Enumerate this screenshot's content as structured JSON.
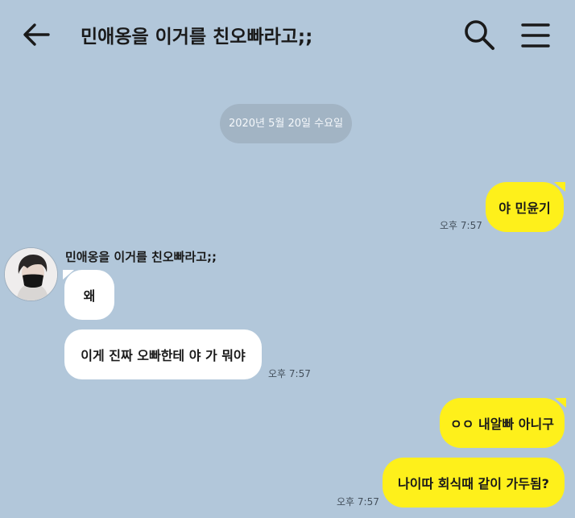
{
  "header": {
    "title": "민애옹을 이거를 친오빠라고;;",
    "back_icon": "arrow-left-icon",
    "search_icon": "search-icon",
    "menu_icon": "hamburger-menu-icon"
  },
  "date_divider": "2020년 5월 20일 수요일",
  "sender": {
    "name": "민애옹을 이거를 친오빠라고;;",
    "avatar_icon": "profile-photo"
  },
  "messages": [
    {
      "from": "me",
      "text": "야 민윤기",
      "time": "오후 7:57"
    },
    {
      "from": "other",
      "text": "왜",
      "time": ""
    },
    {
      "from": "other",
      "text": "이게 진짜 오빠한테 야 가 뭐야",
      "time": "오후 7:57"
    },
    {
      "from": "me",
      "text": "ㅇㅇ 내알빠 아니구",
      "time": ""
    },
    {
      "from": "me",
      "text": "나이따 회식때 같이 가두됨?",
      "time": "오후 7:57"
    }
  ],
  "colors": {
    "background": "#b2c7da",
    "my_bubble": "#fef01b",
    "other_bubble": "#ffffff",
    "date_pill": "#a2b4c4"
  }
}
